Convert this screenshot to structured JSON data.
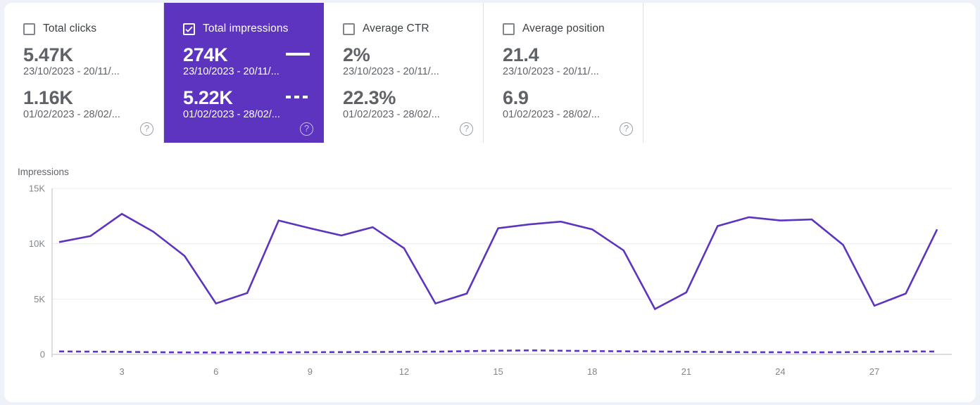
{
  "cards": [
    {
      "id": "total-clicks",
      "label": "Total clicks",
      "checked": false,
      "selected": false,
      "primary_value": "5.47K",
      "primary_range": "23/10/2023 - 20/11/...",
      "compare_value": "1.16K",
      "compare_range": "01/02/2023 - 28/02/...",
      "help_glyph": "?"
    },
    {
      "id": "total-impressions",
      "label": "Total impressions",
      "checked": true,
      "selected": true,
      "primary_value": "274K",
      "primary_range": "23/10/2023 - 20/11/...",
      "compare_value": "5.22K",
      "compare_range": "01/02/2023 - 28/02/...",
      "help_glyph": "?"
    },
    {
      "id": "average-ctr",
      "label": "Average CTR",
      "checked": false,
      "selected": false,
      "primary_value": "2%",
      "primary_range": "23/10/2023 - 20/11/...",
      "compare_value": "22.3%",
      "compare_range": "01/02/2023 - 28/02/...",
      "help_glyph": "?"
    },
    {
      "id": "average-position",
      "label": "Average position",
      "checked": false,
      "selected": false,
      "primary_value": "21.4",
      "primary_range": "23/10/2023 - 20/11/...",
      "compare_value": "6.9",
      "compare_range": "01/02/2023 - 28/02/...",
      "help_glyph": "?"
    }
  ],
  "colors": {
    "accent_purple": "#5c34bf",
    "card_border": "#dfe1e5",
    "text_primary": "#3c4043",
    "text_secondary": "#5f6368",
    "tick_text": "#80868b",
    "gridline": "#ececec",
    "page_background": "#eef1f7"
  },
  "chart_data": {
    "type": "line",
    "title": "",
    "ylabel": "Impressions",
    "xlabel": "",
    "grid": true,
    "legend_position": "in-cards",
    "ylim": [
      0,
      15000
    ],
    "yticks": [
      0,
      5000,
      10000,
      15000
    ],
    "ytick_labels": [
      "0",
      "5K",
      "10K",
      "15K"
    ],
    "x": [
      1,
      2,
      3,
      4,
      5,
      6,
      7,
      8,
      9,
      10,
      11,
      12,
      13,
      14,
      15,
      16,
      17,
      18,
      19,
      20,
      21,
      22,
      23,
      24,
      25,
      26,
      27,
      28,
      29
    ],
    "xticks": [
      3,
      6,
      9,
      12,
      15,
      18,
      21,
      24,
      27
    ],
    "xtick_labels": [
      "3",
      "6",
      "9",
      "12",
      "15",
      "18",
      "21",
      "24",
      "27"
    ],
    "series": [
      {
        "name": "Total impressions (23/10/2023 - 20/11/...)",
        "style": "solid",
        "color": "#5c34bf",
        "values": [
          10150,
          10700,
          12700,
          11100,
          8900,
          4600,
          5550,
          12100,
          11400,
          10750,
          11500,
          9600,
          4600,
          5500,
          11400,
          11750,
          12000,
          11300,
          9400,
          4100,
          5600,
          11600,
          12400,
          12100,
          12200,
          9900,
          4400,
          5500,
          11300
        ]
      },
      {
        "name": "Total impressions (01/02/2023 - 28/02/...)",
        "style": "dashed",
        "color": "#5c34bf",
        "values": [
          270,
          250,
          230,
          200,
          175,
          165,
          170,
          180,
          195,
          205,
          215,
          230,
          250,
          290,
          330,
          360,
          330,
          300,
          280,
          260,
          235,
          215,
          200,
          190,
          185,
          195,
          230,
          265,
          260
        ]
      }
    ]
  }
}
